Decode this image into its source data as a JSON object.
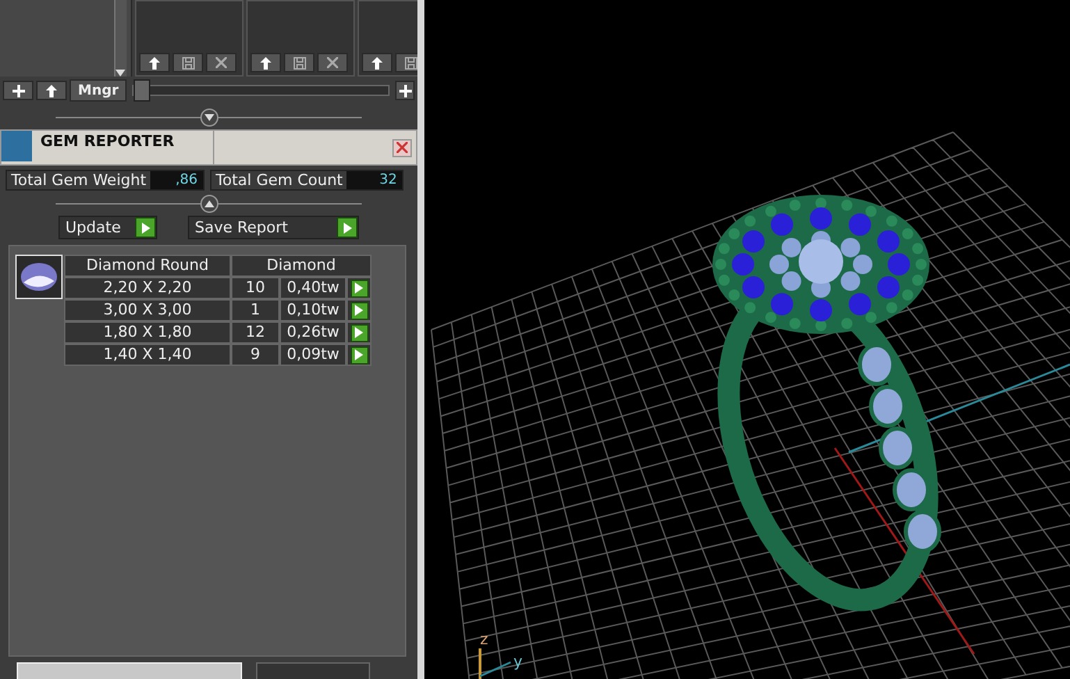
{
  "library": {
    "manager_button": "Mngr",
    "slider": {
      "level": 0
    }
  },
  "reporter": {
    "title": "GEM REPORTER",
    "totals": [
      {
        "label": "Total Gem Weight",
        "value": ",86"
      },
      {
        "label": "Total Gem Count",
        "value": "32"
      }
    ],
    "actions": [
      "Update",
      "Save Report"
    ],
    "table": {
      "columns": [
        "Diamond Round",
        "Diamond"
      ],
      "rows": [
        {
          "size": "2,20 X 2,20",
          "count": "10",
          "weight": "0,40tw"
        },
        {
          "size": "3,00 X 3,00",
          "count": "1",
          "weight": "0,10tw"
        },
        {
          "size": "1,80 X 1,80",
          "count": "12",
          "weight": "0,26tw"
        },
        {
          "size": "1,40 X 1,40",
          "count": "9",
          "weight": "0,09tw"
        }
      ]
    }
  },
  "viewport": {
    "axes": [
      "z",
      "y"
    ]
  }
}
